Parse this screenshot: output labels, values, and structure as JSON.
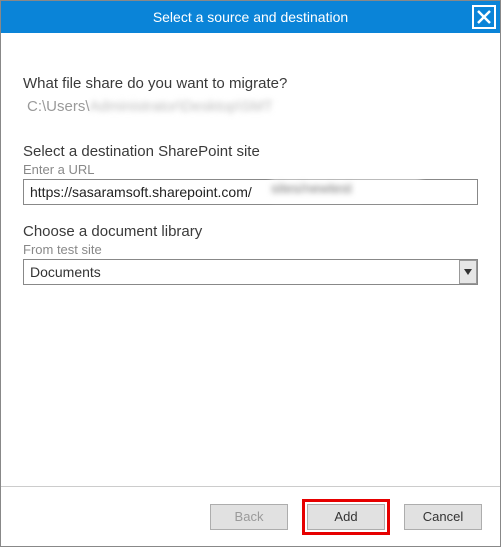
{
  "titlebar": {
    "title": "Select a source and destination"
  },
  "content": {
    "q_migrate": "What file share do you want to migrate?",
    "path_prefix": "C:\\Users\\",
    "path_blur": "Administrator\\Desktop\\SMT",
    "dest_label": "Select a destination SharePoint site",
    "enter_url_label": "Enter a URL",
    "url_value": "https://sasaramsoft.sharepoint.com/",
    "url_blur": "sites/newtest",
    "choose_lib_label": "Choose a document library",
    "lib_sub": "From test site",
    "lib_selected": "Documents"
  },
  "footer": {
    "back": "Back",
    "add": "Add",
    "cancel": "Cancel"
  }
}
